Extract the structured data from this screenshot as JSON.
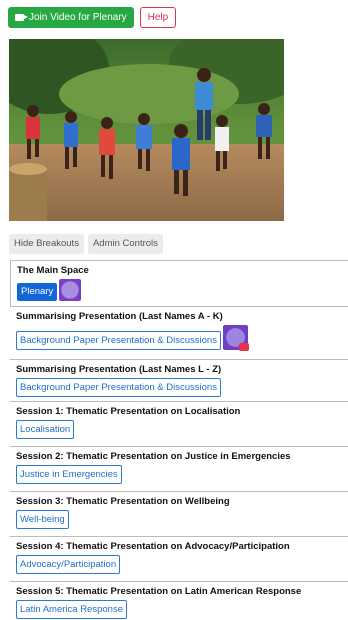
{
  "toolbar": {
    "join_label": "Join Video for Plenary",
    "help_label": "Help"
  },
  "tabs": [
    {
      "label": "Hide Breakouts"
    },
    {
      "label": "Admin Controls"
    }
  ],
  "rooms": [
    {
      "title": "The Main Space",
      "button": "Plenary"
    },
    {
      "title": "Summarising Presentation (Last Names A - K)",
      "button": "Background Paper Presentation & Discussions"
    },
    {
      "title": "Summarising Presentation (Last Names L - Z)",
      "button": "Background Paper Presentation & Discussions"
    },
    {
      "title": "Session 1: Thematic Presentation on Localisation",
      "button": "Localisation"
    },
    {
      "title": "Session 2: Thematic Presentation on Justice in Emergencies",
      "button": "Justice in Emergencies"
    },
    {
      "title": "Session 3: Thematic Presentation on Wellbeing",
      "button": "Well-being"
    },
    {
      "title": "Session 4: Thematic Presentation on Advocacy/Participation",
      "button": "Advocacy/Participation"
    },
    {
      "title": "Session 5: Thematic Presentation on Latin American Response",
      "button": "Latin America Response"
    }
  ],
  "colors": {
    "join": "#27a844",
    "help": "#dc3545",
    "plenary": "#1366d6",
    "link": "#2a7ad3"
  },
  "icons": [
    "camera-icon",
    "participant-avatar-icon",
    "muted-badge-icon"
  ]
}
